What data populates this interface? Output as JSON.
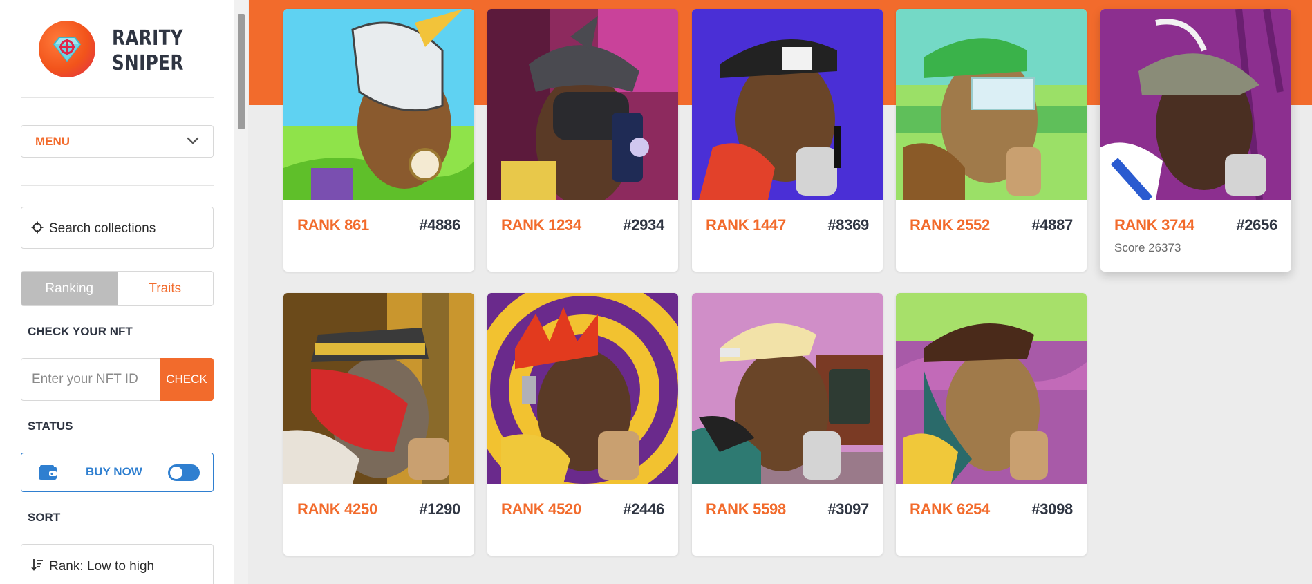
{
  "brand": {
    "line1": "RARITY",
    "line2": "SNIPER"
  },
  "sidebar": {
    "menu_label": "MENU",
    "search_text": "Search collections",
    "tabs": [
      {
        "label": "Ranking",
        "active": true
      },
      {
        "label": "Traits",
        "active": false
      }
    ],
    "check_title": "CHECK YOUR NFT",
    "nft_input_placeholder": "Enter your NFT ID",
    "check_button": "CHECK",
    "status_title": "STATUS",
    "buy_now_label": "BUY NOW",
    "buy_now_enabled": true,
    "sort_title": "SORT",
    "sort_value": "Rank: Low to high"
  },
  "colors": {
    "accent": "#f26b2c",
    "blue": "#2f7fd0",
    "dark": "#2f3542"
  },
  "cards": [
    {
      "rank": "RANK 861",
      "id": "#4886",
      "score": "",
      "bg": "#5fd2f2"
    },
    {
      "rank": "RANK 1234",
      "id": "#2934",
      "score": "",
      "bg": "#8d2a5e"
    },
    {
      "rank": "RANK 1447",
      "id": "#8369",
      "score": "",
      "bg": "#4a2fd6"
    },
    {
      "rank": "RANK 2552",
      "id": "#4887",
      "score": "",
      "bg": "#74d9c6"
    },
    {
      "rank": "RANK 3744",
      "id": "#2656",
      "score": "Score 26373",
      "bg": "#8c2f8f"
    },
    {
      "rank": "RANK 4250",
      "id": "#1290",
      "score": "",
      "bg": "#6b4a1a"
    },
    {
      "rank": "RANK 4520",
      "id": "#2446",
      "score": "",
      "bg": "#6a2a8c"
    },
    {
      "rank": "RANK 5598",
      "id": "#3097",
      "score": "",
      "bg": "#d08ec8"
    },
    {
      "rank": "RANK 6254",
      "id": "#3098",
      "score": "",
      "bg": "#a85aa8"
    }
  ]
}
